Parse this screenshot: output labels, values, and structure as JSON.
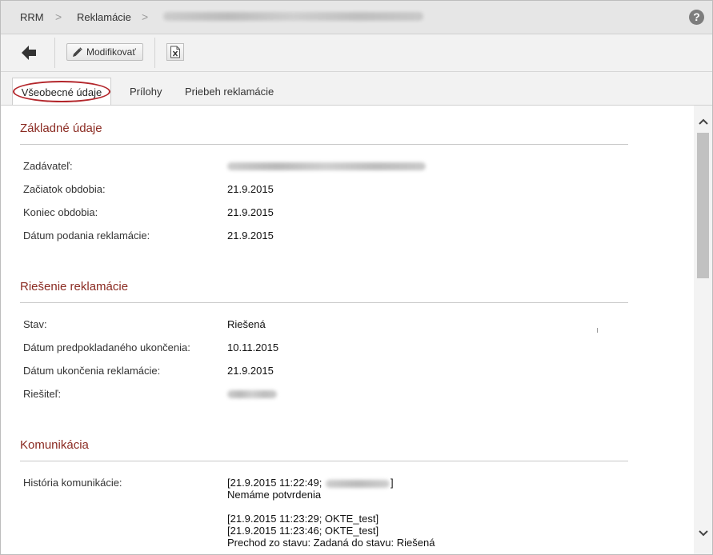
{
  "breadcrumb": {
    "items": [
      "RRM",
      "Reklamácie"
    ],
    "separator": ">"
  },
  "toolbar": {
    "modify_label": "Modifikovať",
    "back_icon": "arrow-left-icon",
    "edit_icon": "pencil-icon",
    "export_icon": "excel-export-icon",
    "help_icon": "help-icon",
    "help_symbol": "?"
  },
  "tabs": [
    {
      "label": "Všeobecné údaje",
      "active": true
    },
    {
      "label": "Prílohy",
      "active": false
    },
    {
      "label": "Priebeh reklamácie",
      "active": false
    }
  ],
  "sections": {
    "basic": {
      "title": "Základné údaje",
      "fields": [
        {
          "label": "Zadávateľ:",
          "value": ""
        },
        {
          "label": "Začiatok obdobia:",
          "value": "21.9.2015"
        },
        {
          "label": "Koniec obdobia:",
          "value": "21.9.2015"
        },
        {
          "label": "Dátum podania reklamácie:",
          "value": "21.9.2015"
        }
      ]
    },
    "resolution": {
      "title": "Riešenie reklamácie",
      "fields": [
        {
          "label": "Stav:",
          "value": "Riešená"
        },
        {
          "label": "Dátum predpokladaného ukončenia:",
          "value": "10.11.2015"
        },
        {
          "label": "Dátum ukončenia reklamácie:",
          "value": "21.9.2015"
        },
        {
          "label": "Riešiteľ:",
          "value": ""
        }
      ]
    },
    "communication": {
      "title": "Komunikácia",
      "history_label": "História komunikácie:",
      "lines": [
        "[21.9.2015 11:22:49;",
        "]",
        "Nemáme potvrdenia",
        "[21.9.2015 11:23:29; OKTE_test]",
        "[21.9.2015 11:23:46; OKTE_test]",
        "Prechod zo stavu: Zadaná do stavu: Riešená"
      ]
    }
  },
  "colors": {
    "section_title": "#8b2b22",
    "active_tab_highlight": "#b3262b"
  }
}
